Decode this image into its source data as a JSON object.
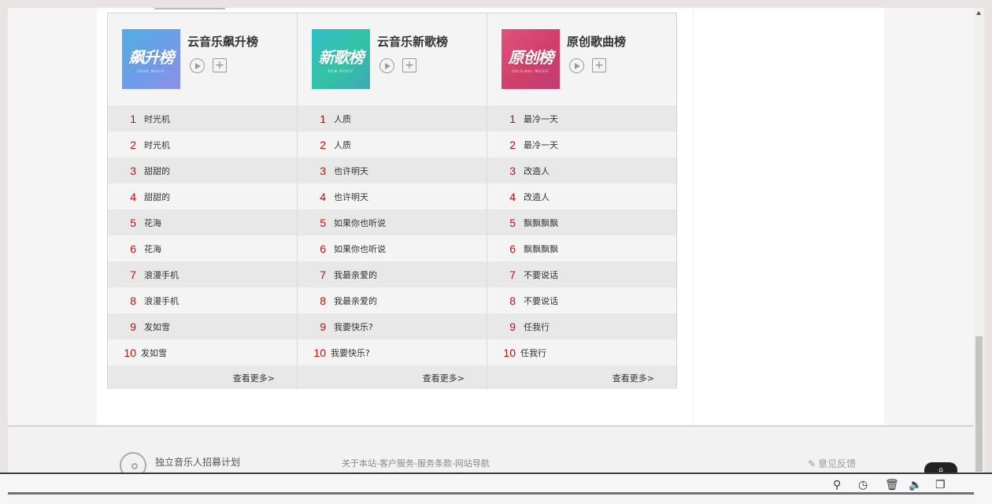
{
  "boards": [
    {
      "cover_text": "飙升榜",
      "cover_sub": "SOAR MUSIC",
      "title": "云音乐飙升榜",
      "songs": [
        "时光机",
        "时光机",
        "甜甜的",
        "甜甜的",
        "花海",
        "花海",
        "浪漫手机",
        "浪漫手机",
        "发如雪",
        "发如雪"
      ],
      "more": "查看更多>"
    },
    {
      "cover_text": "新歌榜",
      "cover_sub": "NEW MUSIC",
      "title": "云音乐新歌榜",
      "songs": [
        "人质",
        "人质",
        "也许明天",
        "也许明天",
        "如果你也听说",
        "如果你也听说",
        "我最亲爱的",
        "我最亲爱的",
        "我要快乐?",
        "我要快乐?"
      ],
      "more": "查看更多>"
    },
    {
      "cover_text": "原创榜",
      "cover_sub": "ORIGINAL MUSIC",
      "title": "原创歌曲榜",
      "songs": [
        "最冷一天",
        "最冷一天",
        "改造人",
        "改造人",
        "飘飘飘飘",
        "飘飘飘飘",
        "不要说话",
        "不要说话",
        "任我行",
        "任我行"
      ],
      "more": "查看更多>"
    }
  ],
  "ranks": [
    "1",
    "2",
    "3",
    "4",
    "5",
    "6",
    "7",
    "8",
    "9",
    "10"
  ],
  "footer": {
    "recruit": "独立音乐人招募计划",
    "links": "关于本站-客户服务-服务条款-网站导航",
    "feedback": "意见反馈"
  },
  "icons": {
    "play": "play-icon",
    "add": "add-icon",
    "pen": "pen-icon",
    "pin": "pin-icon",
    "clock": "clock-icon",
    "trash": "trash-icon",
    "volume": "volume-icon",
    "window": "window-icon"
  }
}
